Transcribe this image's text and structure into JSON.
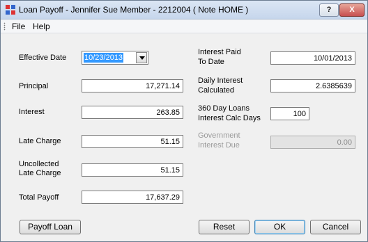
{
  "window": {
    "title": "Loan Payoff - Jennifer Sue Member - 2212004 ( Note HOME )",
    "help_btn": "?",
    "close_btn": "X"
  },
  "menu": {
    "file": "File",
    "help": "Help"
  },
  "left": {
    "effective_date_label": "Effective Date",
    "effective_date_value": "10/23/2013",
    "principal_label": "Principal",
    "principal_value": "17,271.14",
    "interest_label": "Interest",
    "interest_value": "263.85",
    "late_charge_label": "Late Charge",
    "late_charge_value": "51.15",
    "uncollected_label_1": "Uncollected",
    "uncollected_label_2": "Late Charge",
    "uncollected_value": "51.15",
    "total_payoff_label": "Total Payoff",
    "total_payoff_value": "17,637.29"
  },
  "right": {
    "interest_paid_label_1": "Interest Paid",
    "interest_paid_label_2": "To Date",
    "interest_paid_value": "10/01/2013",
    "daily_interest_label_1": "Daily Interest",
    "daily_interest_label_2": "Calculated",
    "daily_interest_value": "2.6385639",
    "calc_days_label_1": "360 Day Loans",
    "calc_days_label_2": "Interest Calc Days",
    "calc_days_value": "100",
    "gov_interest_label_1": "Government",
    "gov_interest_label_2": "Interest Due",
    "gov_interest_value": "0.00"
  },
  "buttons": {
    "payoff_loan": "Payoff Loan",
    "reset": "Reset",
    "ok": "OK",
    "cancel": "Cancel"
  }
}
